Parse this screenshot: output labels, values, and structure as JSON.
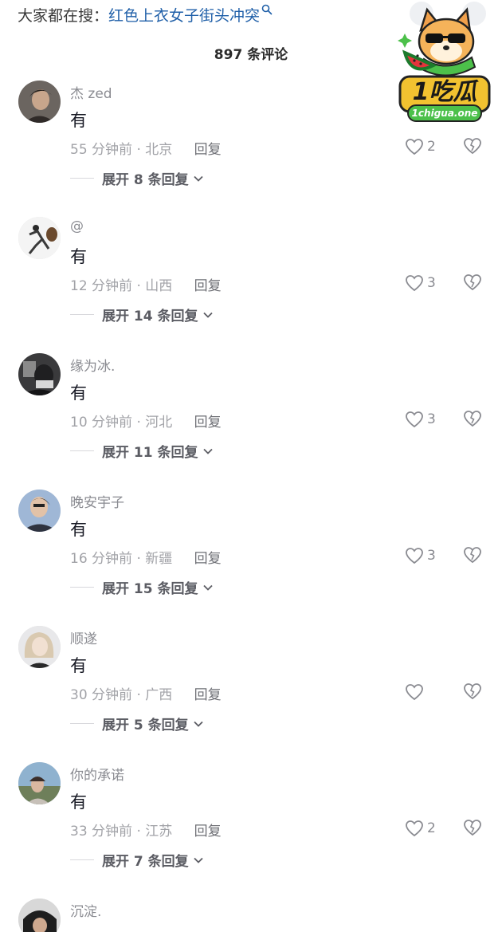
{
  "header": {
    "search_prefix": "大家都在搜：",
    "search_query": "红色上衣女子街头冲突",
    "comment_count": "897 条评论"
  },
  "watermark": {
    "brand": "1吃瓜",
    "site": "1chigua.one"
  },
  "labels": {
    "reply": "回复"
  },
  "colors": {
    "link": "#1f5fa8",
    "muted": "#a1a2a7",
    "text": "#161823"
  },
  "comments": [
    {
      "user": "杰 zed",
      "text": "有",
      "time": "55 分钟前 · 北京",
      "likes": "2",
      "expand": "展开 8 条回复"
    },
    {
      "user": "@",
      "text": "有",
      "time": "12 分钟前 · 山西",
      "likes": "3",
      "expand": "展开 14 条回复"
    },
    {
      "user": "缘为冰.",
      "text": "有",
      "time": "10 分钟前 · 河北",
      "likes": "3",
      "expand": "展开 11 条回复"
    },
    {
      "user": "晚安宇子",
      "text": "有",
      "time": "16 分钟前 · 新疆",
      "likes": "3",
      "expand": "展开 15 条回复"
    },
    {
      "user": "顺遂",
      "text": "有",
      "time": "30 分钟前 · 广西",
      "likes": "",
      "expand": "展开 5 条回复"
    },
    {
      "user": "你的承诺",
      "text": "有",
      "time": "33 分钟前 · 江苏",
      "likes": "2",
      "expand": "展开 7 条回复"
    },
    {
      "user": "沉淀."
    }
  ]
}
